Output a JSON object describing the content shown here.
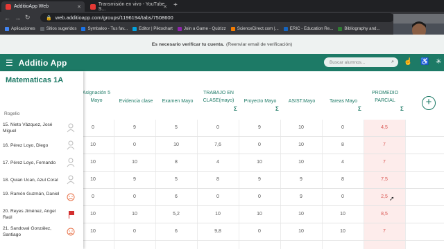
{
  "browser": {
    "tabs": [
      {
        "label": "AdditioApp Web",
        "active": true,
        "favicon_color": "#e53935"
      },
      {
        "label": "Transmisión en vivo - YouTube S...",
        "active": false,
        "favicon_color": "#e53935"
      }
    ],
    "url": "web.additioapp.com/groups/1196194/tabs/7508600",
    "bookmarks": [
      {
        "label": "Aplicaciones",
        "color": "#4285f4"
      },
      {
        "label": "Sitios sugeridos",
        "color": "#5f6368"
      },
      {
        "label": "Symbaloo - Tus fav...",
        "color": "#1a73e8"
      },
      {
        "label": "Editor | Piktochart",
        "color": "#00a3e0"
      },
      {
        "label": "Join a Game - Quizizz",
        "color": "#8e24aa"
      },
      {
        "label": "ScienceDirect.com |...",
        "color": "#f57c00"
      },
      {
        "label": "ERIC - Education Re...",
        "color": "#1565c0"
      },
      {
        "label": "Bibliography and...",
        "color": "#2e7d32"
      }
    ]
  },
  "banner": {
    "bold": "Es necesario verificar tu cuenta.",
    "link": "(Reenviar email de verificación)"
  },
  "app": {
    "logo": "Additio App",
    "search_placeholder": "Buscar alumnos...",
    "course_title": "Matematicas 1A"
  },
  "columns": [
    {
      "label": "Asignación 5 Mayo",
      "sum": false
    },
    {
      "label": "Evidencia clase",
      "sum": false
    },
    {
      "label": "Examen Mayo",
      "sum": false
    },
    {
      "label": "TRABAJO EN CLASE(mayo)",
      "sum": true
    },
    {
      "label": "Proyecto Mayo",
      "sum": true
    },
    {
      "label": "ASIST.Mayo",
      "sum": false
    },
    {
      "label": "Tareas Mayo",
      "sum": true
    },
    {
      "label": "PROMEDIO PARCIAL",
      "sum": true
    }
  ],
  "ghost_row": "Rogelio",
  "students": [
    {
      "name": "15. Nieto Vázquez, José Miguel",
      "icon": "person",
      "values": [
        "0",
        "9",
        "5",
        "0",
        "9",
        "10",
        "0",
        "4,5"
      ]
    },
    {
      "name": "16. Pérez Loyo, Diego",
      "icon": "person",
      "values": [
        "10",
        "0",
        "10",
        "7,6",
        "0",
        "10",
        "8",
        "7"
      ]
    },
    {
      "name": "17. Pérez Loyo, Fernando",
      "icon": "person",
      "values": [
        "10",
        "10",
        "8",
        "4",
        "10",
        "10",
        "4",
        "7"
      ]
    },
    {
      "name": "18. Quian Ucan, Azul Coral",
      "icon": "person",
      "values": [
        "10",
        "9",
        "5",
        "8",
        "9",
        "9",
        "8",
        "7,5"
      ]
    },
    {
      "name": "19. Ramón Guzmán, Daniel",
      "icon": "sad",
      "values": [
        "0",
        "0",
        "6",
        "0",
        "0",
        "9",
        "0",
        "2,5"
      ]
    },
    {
      "name": "20. Reyes Jiménez, Angel Raúl",
      "icon": "flag",
      "values": [
        "10",
        "10",
        "5,2",
        "10",
        "10",
        "10",
        "10",
        "8,5"
      ]
    },
    {
      "name": "21. Sandoval González, Santiago",
      "icon": "sad",
      "values": [
        "10",
        "0",
        "6",
        "9,8",
        "0",
        "10",
        "10",
        "7"
      ]
    }
  ],
  "colors": {
    "brand": "#1d7a66",
    "average_bg": "#fdeceb",
    "average_text": "#d9534f"
  }
}
